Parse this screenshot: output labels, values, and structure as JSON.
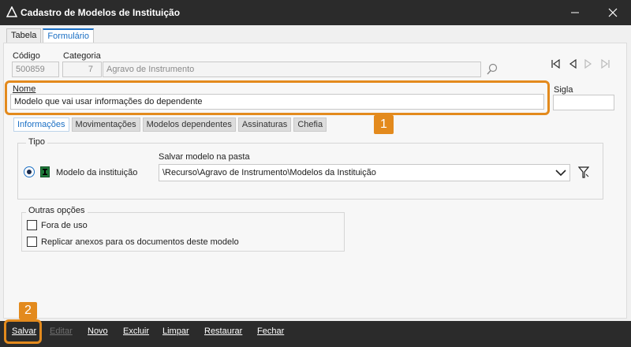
{
  "window": {
    "title": "Cadastro de Modelos de Instituição"
  },
  "top_tabs": [
    {
      "label": "Tabela"
    },
    {
      "label": "Formulário"
    }
  ],
  "fields": {
    "codigo": {
      "label": "Código",
      "value": "500859"
    },
    "categoria": {
      "label": "Categoria",
      "code": "7",
      "value": "Agravo de Instrumento"
    },
    "nome": {
      "label": "Nome",
      "value": "Modelo que vai usar informações do dependente"
    },
    "sigla": {
      "label": "Sigla",
      "value": ""
    }
  },
  "inner_tabs": [
    {
      "label": "Informações"
    },
    {
      "label": "Movimentações"
    },
    {
      "label": "Modelos dependentes"
    },
    {
      "label": "Assinaturas"
    },
    {
      "label": "Chefia"
    }
  ],
  "tipo": {
    "label": "Tipo",
    "radio_label": "Modelo da instituição",
    "folder_label": "Salvar modelo na pasta",
    "folder_value": "\\Recurso\\Agravo de Instrumento\\Modelos da Instituição"
  },
  "outras": {
    "label": "Outras opções",
    "fora_de_uso": "Fora de uso",
    "replicar": "Replicar anexos para os documentos deste modelo"
  },
  "badges": {
    "one": "1",
    "two": "2"
  },
  "toolbar": {
    "salvar": "Salvar",
    "editar": "Editar",
    "novo": "Novo",
    "excluir": "Excluir",
    "limpar": "Limpar",
    "restaurar": "Restaurar",
    "fechar": "Fechar"
  },
  "colors": {
    "accent": "#1a6fc4",
    "highlight": "#e38a1d",
    "titlebar": "#2b2b2b"
  },
  "icons": [
    "app-icon",
    "minimize-icon",
    "close-icon",
    "search-icon",
    "first-record-icon",
    "previous-record-icon",
    "next-record-icon",
    "last-record-icon",
    "chevron-down-icon",
    "filter-icon",
    "institution-type-icon"
  ]
}
